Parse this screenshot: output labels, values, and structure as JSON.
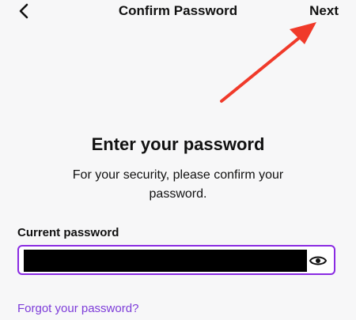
{
  "nav": {
    "title": "Confirm Password",
    "next_label": "Next",
    "back_icon": "chevron-left-icon"
  },
  "main": {
    "heading": "Enter your password",
    "subtitle": "For your security, please confirm your password."
  },
  "form": {
    "password_label": "Current password",
    "password_value_masked": true,
    "show_password_icon": "eye-icon",
    "accent_color": "#8a2be2"
  },
  "links": {
    "forgot_password": "Forgot your password?"
  },
  "annotation": {
    "arrow_color": "#f03a2a",
    "points_to": "next-button"
  }
}
